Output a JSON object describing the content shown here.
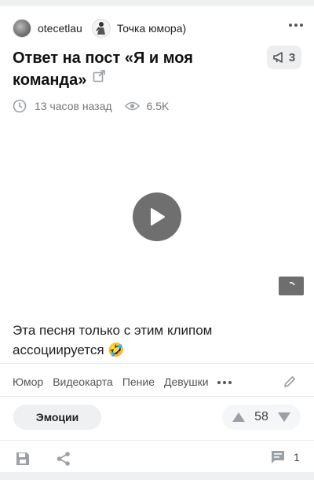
{
  "post": {
    "author": "otecetlau",
    "community": "Точка юмора)",
    "title": "Ответ на пост «Я и моя команда»",
    "boost_count": "3",
    "time_ago": "13 часов назад",
    "views": "6.5K",
    "body": "Эта песня только с этим клипом ассоциируется 🤣",
    "tags": [
      "Юмор",
      "Видеокарта",
      "Пение",
      "Девушки"
    ],
    "emotions_label": "Эмоции",
    "rating": "58",
    "comments_count": "1"
  },
  "colors": {
    "accent": "#111111",
    "icon": "#9aa0a6",
    "play_button": "#6f6f6f",
    "chip_bg": "#eef0f2"
  },
  "icons": [
    "clock-icon",
    "eye-icon",
    "megaphone-icon",
    "external-link-icon",
    "play-icon",
    "pencil-icon",
    "arrow-up-icon",
    "arrow-down-icon",
    "save-icon",
    "share-icon",
    "comment-icon",
    "more-icon"
  ]
}
